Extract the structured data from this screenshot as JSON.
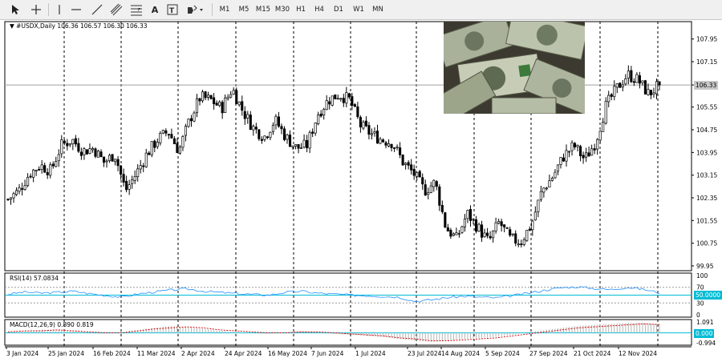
{
  "toolbar": {
    "tools": [
      {
        "icon": "cursor-icon"
      },
      {
        "icon": "crosshair-icon"
      },
      {
        "icon": "vertical-line-icon"
      },
      {
        "icon": "horizontal-line-icon"
      },
      {
        "icon": "trendline-icon"
      },
      {
        "icon": "equidistant-channel-icon"
      },
      {
        "icon": "fibonacci-icon"
      },
      {
        "icon": "text-icon",
        "label": "A"
      },
      {
        "icon": "text-label-icon"
      },
      {
        "icon": "shapes-icon"
      }
    ],
    "timeframes": [
      "M1",
      "M5",
      "M15",
      "M30",
      "H1",
      "H4",
      "D1",
      "W1",
      "MN"
    ]
  },
  "chart": {
    "header": "#USDX,Daily  106.36 106.57 106.30 106.33",
    "current_price_label": "106.33",
    "rsi_header": "RSI(14) 57.0834",
    "macd_header": "MACD(12,26,9) 0.890 0.819",
    "rsi_current_label": "50.0000",
    "macd_zero_label": "0.000"
  },
  "chart_data": {
    "type": "candlestick",
    "symbol": "#USDX",
    "timeframe": "Daily",
    "ohlc_current": {
      "open": 106.36,
      "high": 106.57,
      "low": 106.3,
      "close": 106.33
    },
    "price_axis_ticks": [
      "107.95",
      "107.15",
      "106.33",
      "105.55",
      "104.75",
      "103.95",
      "103.15",
      "102.35",
      "101.55",
      "100.75",
      "99.95"
    ],
    "date_axis_ticks": [
      "3 Jan 2024",
      "25 Jan 2024",
      "16 Feb 2024",
      "11 Mar 2024",
      "2 Apr 2024",
      "24 Apr 2024",
      "16 May 2024",
      "7 Jun 2024",
      "1 Jul 2024",
      "23 Jul 2024",
      "14 Aug 2024",
      "5 Sep 2024",
      "27 Sep 2024",
      "21 Oct 2024",
      "12 Nov 2024"
    ],
    "ylim": [
      99.95,
      108.45
    ],
    "close_path": [
      102.3,
      102.6,
      103.2,
      103.5,
      103.3,
      104.2,
      104.4,
      104.0,
      104.1,
      103.6,
      103.9,
      102.6,
      103.2,
      103.9,
      104.4,
      104.7,
      104.0,
      105.1,
      105.9,
      105.8,
      105.5,
      106.2,
      105.4,
      104.8,
      104.5,
      105.1,
      104.5,
      104.1,
      104.2,
      105.3,
      105.8,
      106.0,
      105.8,
      104.9,
      104.6,
      104.4,
      104.3,
      103.6,
      103.2,
      102.6,
      102.9,
      101.3,
      100.9,
      101.8,
      101.3,
      100.8,
      101.5,
      100.9,
      100.8,
      101.4,
      102.6,
      103.1,
      103.8,
      104.2,
      103.7,
      104.3,
      105.6,
      106.2,
      106.7,
      106.5,
      106.0,
      106.33
    ],
    "rsi": {
      "period": 14,
      "value": 57.0834,
      "axis_ticks": [
        "100",
        "70",
        "50",
        "30",
        "0"
      ],
      "levels": [
        70,
        30
      ],
      "current_level": 50.0,
      "series": [
        52,
        58,
        55,
        57,
        60,
        54,
        49,
        45,
        53,
        58,
        63,
        66,
        60,
        57,
        54,
        52,
        50,
        57,
        60,
        55,
        53,
        50,
        49,
        47,
        45,
        34,
        38,
        44,
        47,
        45,
        43,
        49,
        55,
        63,
        69,
        71,
        67,
        64,
        70,
        65,
        56
      ]
    },
    "macd": {
      "params": [
        12,
        26,
        9
      ],
      "value": 0.89,
      "signal": 0.819,
      "axis_ticks": [
        "1.091",
        "0.000",
        "-0.994"
      ],
      "histogram": [
        0.1,
        0.2,
        0.3,
        0.3,
        0.2,
        0.1,
        -0.1,
        0.1,
        0.3,
        0.5,
        0.7,
        0.6,
        0.4,
        0.2,
        0.1,
        0.0,
        -0.1,
        0.0,
        0.2,
        0.1,
        -0.1,
        -0.2,
        -0.3,
        -0.4,
        -0.6,
        -0.8,
        -0.9,
        -0.8,
        -0.6,
        -0.5,
        -0.4,
        -0.2,
        0.1,
        0.3,
        0.5,
        0.7,
        0.8,
        0.9,
        1.0,
        1.0,
        0.9
      ],
      "signal_series": [
        0.1,
        0.2,
        0.2,
        0.3,
        0.2,
        0.1,
        0.0,
        0.0,
        0.2,
        0.4,
        0.5,
        0.6,
        0.5,
        0.3,
        0.2,
        0.1,
        0.0,
        0.0,
        0.1,
        0.1,
        0.0,
        -0.1,
        -0.2,
        -0.3,
        -0.5,
        -0.6,
        -0.8,
        -0.8,
        -0.7,
        -0.6,
        -0.5,
        -0.3,
        -0.1,
        0.1,
        0.3,
        0.5,
        0.6,
        0.7,
        0.8,
        0.9,
        0.82
      ]
    }
  },
  "colors": {
    "background": "#ffffff",
    "candle": "#000000",
    "rsi_line": "#1e90ff",
    "level_line": "#00bcd4",
    "macd_histogram": "#b4b4b4",
    "macd_signal": "#d00000",
    "grid_dash": "#000000",
    "current_price_line": "#a0a0a0"
  }
}
